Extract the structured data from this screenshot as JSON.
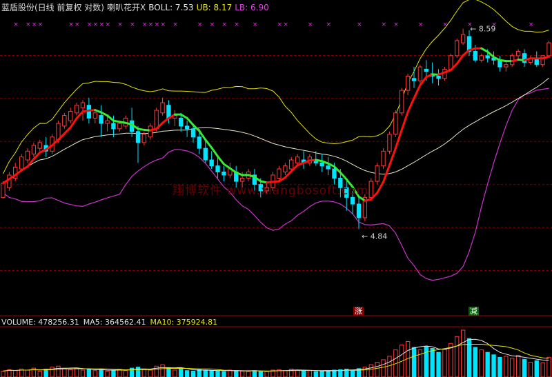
{
  "header": {
    "stock": "蓝盾股份(日线 前复权 对数)",
    "indicator": "喇叭花开X",
    "boll": "BOLL: 7.53",
    "ub": "UB: 8.17",
    "lb": "LB: 6.90"
  },
  "volume_header": {
    "volume": "VOLUME: 478256.31",
    "ma5": "MA5: 364562.41",
    "ma10": "MA10: 375924.81"
  },
  "annotations": {
    "high": "8.59",
    "low": "4.84"
  },
  "signals": {
    "zhang": "涨",
    "jian": "减"
  },
  "watermark": "翔博软件 www.xiangbosoft.com",
  "colors": {
    "bg": "#000000",
    "up": "#ff3b3b",
    "down": "#00e5ff",
    "mid_up": "#ff1010",
    "mid_down": "#33ee33",
    "ub": "#e6e600",
    "lb": "#cc33cc",
    "ma60": "#e8e8c8",
    "grid": "#8a0000",
    "cross": "#dd33dd"
  },
  "chart_data": {
    "type": "candlestick",
    "ylim": [
      3.8,
      9.0
    ],
    "log_scale": true,
    "candles": [
      [
        5.3,
        5.55,
        5.52,
        5.28
      ],
      [
        5.45,
        5.7,
        5.65,
        5.4
      ],
      [
        5.6,
        5.85,
        5.78,
        5.55
      ],
      [
        5.75,
        6.0,
        5.95,
        5.7
      ],
      [
        5.9,
        6.1,
        6.05,
        5.85
      ],
      [
        6.0,
        6.2,
        6.15,
        5.95
      ],
      [
        6.1,
        6.25,
        6.2,
        6.05
      ],
      [
        6.15,
        6.3,
        6.05,
        5.95
      ],
      [
        6.05,
        6.35,
        6.3,
        6.0
      ],
      [
        6.25,
        6.6,
        6.55,
        6.2
      ],
      [
        6.5,
        6.75,
        6.7,
        6.45
      ],
      [
        6.6,
        6.85,
        6.78,
        6.55
      ],
      [
        6.75,
        6.95,
        6.9,
        6.7
      ],
      [
        6.85,
        7.0,
        6.95,
        6.6
      ],
      [
        6.9,
        7.05,
        6.65,
        6.55
      ],
      [
        6.65,
        6.8,
        6.75,
        6.55
      ],
      [
        6.7,
        6.9,
        6.55,
        6.3
      ],
      [
        6.55,
        6.7,
        6.6,
        6.4
      ],
      [
        6.55,
        6.7,
        6.45,
        6.3
      ],
      [
        6.45,
        6.6,
        6.55,
        6.4
      ],
      [
        6.5,
        6.7,
        6.65,
        6.45
      ],
      [
        6.6,
        6.85,
        6.4,
        6.3
      ],
      [
        6.4,
        6.5,
        6.2,
        5.85
      ],
      [
        6.2,
        6.4,
        6.35,
        6.15
      ],
      [
        6.3,
        6.55,
        6.5,
        6.25
      ],
      [
        6.45,
        6.85,
        6.8,
        6.4
      ],
      [
        6.75,
        7.05,
        6.95,
        6.7
      ],
      [
        6.9,
        7.0,
        6.65,
        6.55
      ],
      [
        6.65,
        6.8,
        6.7,
        6.5
      ],
      [
        6.65,
        6.75,
        6.5,
        6.4
      ],
      [
        6.5,
        6.6,
        6.45,
        6.3
      ],
      [
        6.45,
        6.55,
        6.3,
        6.2
      ],
      [
        6.3,
        6.45,
        6.1,
        6.0
      ],
      [
        6.1,
        6.25,
        5.9,
        5.85
      ],
      [
        5.9,
        6.05,
        5.8,
        5.75
      ],
      [
        5.8,
        5.95,
        5.7,
        5.6
      ],
      [
        5.7,
        5.8,
        5.65,
        5.55
      ],
      [
        5.65,
        5.85,
        5.75,
        5.6
      ],
      [
        5.7,
        5.8,
        5.55,
        5.45
      ],
      [
        5.55,
        5.7,
        5.6,
        5.45
      ],
      [
        5.6,
        5.75,
        5.7,
        5.55
      ],
      [
        5.65,
        5.75,
        5.5,
        5.4
      ],
      [
        5.5,
        5.6,
        5.4,
        5.3
      ],
      [
        5.4,
        5.55,
        5.45,
        5.35
      ],
      [
        5.45,
        5.7,
        5.65,
        5.4
      ],
      [
        5.6,
        5.8,
        5.75,
        5.55
      ],
      [
        5.7,
        5.85,
        5.8,
        5.65
      ],
      [
        5.75,
        5.95,
        5.9,
        5.7
      ],
      [
        5.85,
        6.0,
        5.95,
        5.8
      ],
      [
        5.9,
        6.05,
        5.85,
        5.75
      ],
      [
        5.85,
        6.0,
        5.95,
        5.8
      ],
      [
        5.9,
        6.05,
        5.85,
        5.8
      ],
      [
        5.85,
        6.0,
        5.8,
        5.7
      ],
      [
        5.8,
        5.95,
        5.75,
        5.65
      ],
      [
        5.75,
        5.85,
        5.6,
        5.5
      ],
      [
        5.6,
        5.75,
        5.45,
        5.3
      ],
      [
        5.45,
        5.55,
        5.3,
        5.1
      ],
      [
        5.3,
        5.4,
        5.2,
        5.05
      ],
      [
        5.2,
        5.3,
        5.0,
        4.84
      ],
      [
        5.0,
        5.35,
        5.3,
        4.95
      ],
      [
        5.3,
        5.6,
        5.55,
        5.25
      ],
      [
        5.55,
        5.85,
        5.8,
        5.5
      ],
      [
        5.8,
        6.1,
        6.05,
        5.75
      ],
      [
        6.05,
        6.4,
        6.35,
        6.0
      ],
      [
        6.35,
        6.8,
        6.75,
        6.3
      ],
      [
        6.75,
        7.25,
        7.2,
        6.7
      ],
      [
        7.2,
        7.55,
        7.5,
        7.1
      ],
      [
        7.45,
        7.7,
        7.4,
        7.25
      ],
      [
        7.4,
        7.75,
        7.7,
        7.35
      ],
      [
        7.65,
        7.85,
        7.6,
        7.4
      ],
      [
        7.55,
        7.8,
        7.5,
        7.35
      ],
      [
        7.5,
        7.65,
        7.45,
        7.3
      ],
      [
        7.45,
        7.7,
        7.65,
        7.4
      ],
      [
        7.65,
        8.0,
        7.95,
        7.6
      ],
      [
        7.95,
        8.35,
        8.3,
        7.9
      ],
      [
        8.25,
        8.59,
        8.45,
        8.2
      ],
      [
        8.4,
        8.55,
        8.05,
        7.95
      ],
      [
        8.05,
        8.2,
        7.85,
        7.8
      ],
      [
        7.85,
        8.0,
        7.95,
        7.8
      ],
      [
        7.95,
        8.1,
        7.9,
        7.8
      ],
      [
        7.9,
        8.05,
        7.85,
        7.75
      ],
      [
        7.85,
        7.95,
        7.7,
        7.6
      ],
      [
        7.7,
        7.85,
        7.75,
        7.6
      ],
      [
        7.75,
        8.0,
        7.95,
        7.7
      ],
      [
        7.95,
        8.1,
        8.05,
        7.85
      ],
      [
        8.0,
        8.1,
        7.8,
        7.7
      ],
      [
        7.8,
        7.95,
        7.9,
        7.75
      ],
      [
        7.9,
        8.05,
        7.75,
        7.7
      ],
      [
        7.75,
        7.95,
        7.95,
        7.7
      ],
      [
        7.95,
        8.3,
        8.25,
        7.9
      ]
    ],
    "volume": [
      0.12,
      0.15,
      0.13,
      0.16,
      0.14,
      0.18,
      0.12,
      0.16,
      0.2,
      0.22,
      0.18,
      0.15,
      0.17,
      0.14,
      0.16,
      0.13,
      0.15,
      0.12,
      0.14,
      0.16,
      0.13,
      0.18,
      0.2,
      0.15,
      0.14,
      0.22,
      0.25,
      0.18,
      0.14,
      0.16,
      0.13,
      0.12,
      0.15,
      0.14,
      0.13,
      0.12,
      0.11,
      0.14,
      0.13,
      0.12,
      0.11,
      0.13,
      0.12,
      0.11,
      0.14,
      0.15,
      0.13,
      0.16,
      0.14,
      0.12,
      0.13,
      0.11,
      0.12,
      0.13,
      0.14,
      0.15,
      0.16,
      0.14,
      0.17,
      0.2,
      0.25,
      0.3,
      0.35,
      0.42,
      0.55,
      0.65,
      0.72,
      0.6,
      0.55,
      0.62,
      0.58,
      0.5,
      0.56,
      0.68,
      0.82,
      0.95,
      0.78,
      0.6,
      0.55,
      0.5,
      0.45,
      0.4,
      0.42,
      0.38,
      0.44,
      0.36,
      0.3,
      0.33,
      0.29,
      0.4
    ],
    "vol_max_label_units": "relative",
    "high_label": 8.59,
    "low_label": 4.84
  }
}
